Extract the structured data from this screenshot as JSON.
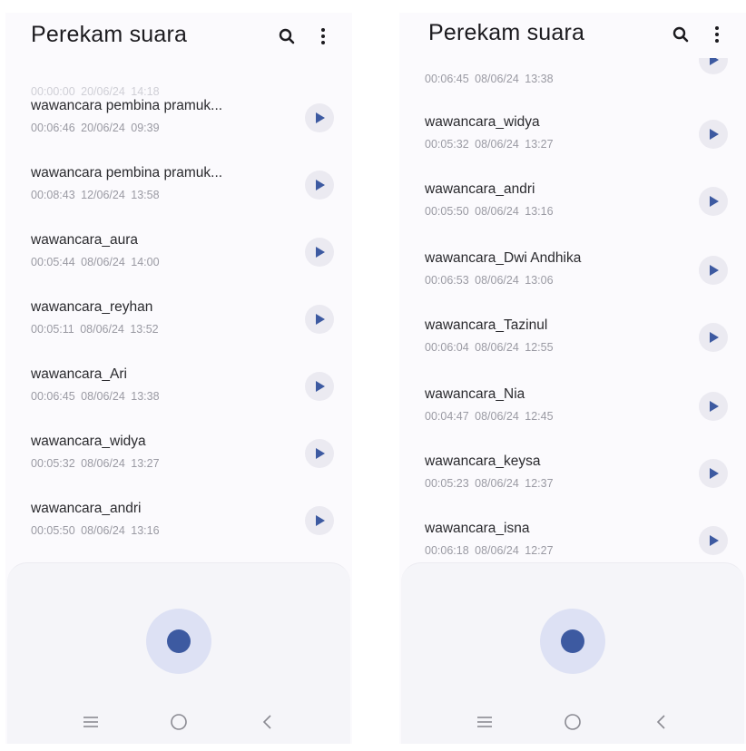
{
  "colors": {
    "accent": "#3d5aa1",
    "record_ring": "#dde1f4",
    "play_button_bg": "#ebeaf1",
    "background": "#fbfafd",
    "panel": "#f5f5f9"
  },
  "left": {
    "app_title": "Perekam suara",
    "header_icons": [
      "search-icon",
      "more-vert-icon"
    ],
    "recordings": [
      {
        "name": "",
        "meta": "00:00:00  20/06/24 14:18"
      },
      {
        "name": "wawancara pembina pramuk...",
        "meta": "00:06:46  20/06/24 09:39"
      },
      {
        "name": "wawancara pembina pramuk...",
        "meta": "00:08:43  12/06/24 13:58"
      },
      {
        "name": "wawancara_aura",
        "meta": "00:05:44  08/06/24 14:00"
      },
      {
        "name": "wawancara_reyhan",
        "meta": "00:05:11  08/06/24 13:52"
      },
      {
        "name": "wawancara_Ari",
        "meta": "00:06:45  08/06/24 13:38"
      },
      {
        "name": "wawancara_widya",
        "meta": "00:05:32  08/06/24 13:27"
      },
      {
        "name": "wawancara_andri",
        "meta": "00:05:50  08/06/24 13:16"
      }
    ],
    "nav_icons": [
      "recents-icon",
      "home-icon",
      "back-icon"
    ]
  },
  "right": {
    "app_title": "Perekam suara",
    "header_icons": [
      "search-icon",
      "more-vert-icon"
    ],
    "recordings": [
      {
        "name": "",
        "meta": "00:06:45  08/06/24 13:38"
      },
      {
        "name": "wawancara_widya",
        "meta": "00:05:32  08/06/24 13:27"
      },
      {
        "name": "wawancara_andri",
        "meta": "00:05:50  08/06/24 13:16"
      },
      {
        "name": "wawancara_Dwi Andhika",
        "meta": "00:06:53  08/06/24 13:06"
      },
      {
        "name": "wawancara_Tazinul",
        "meta": "00:06:04  08/06/24 12:55"
      },
      {
        "name": "wawancara_Nia",
        "meta": "00:04:47  08/06/24 12:45"
      },
      {
        "name": "wawancara_keysa",
        "meta": "00:05:23  08/06/24 12:37"
      },
      {
        "name": "wawancara_isna",
        "meta": "00:06:18  08/06/24 12:27"
      }
    ],
    "nav_icons": [
      "recents-icon",
      "home-icon",
      "back-icon"
    ]
  }
}
